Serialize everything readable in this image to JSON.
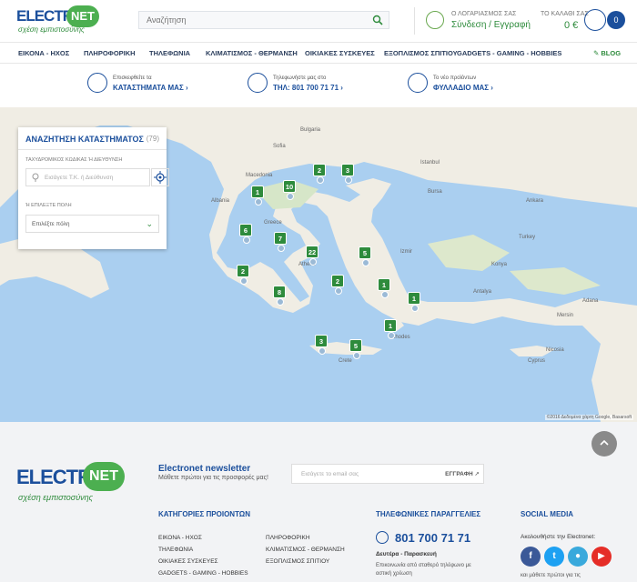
{
  "header": {
    "logo_main": "ELECTRO",
    "logo_net": "NET",
    "logo_tagline": "σχέση εμπιστοσύνης",
    "search_placeholder": "Αναζήτηση",
    "account_label": "Ο ΛΟΓΑΡΙΑΣΜΟΣ ΣΑΣ",
    "account_link": "Σύνδεση / Εγγραφή",
    "cart_label": "ΤΟ ΚΑΛΑΘΙ ΣΑΣ",
    "cart_amount": "0 €",
    "cart_count": "0"
  },
  "nav": {
    "items": [
      "ΕΙΚΟΝΑ - ΗΧΟΣ",
      "ΠΛΗΡΟΦΟΡΙΚΗ",
      "ΤΗΛΕΦΩΝΙΑ",
      "ΚΛΙΜΑΤΙΣΜΟΣ - ΘΕΡΜΑΝΣΗ",
      "ΟΙΚΙΑΚΕΣ ΣΥΣΚΕΥΕΣ",
      "ΕΞΟΠΛΙΣΜΟΣ ΣΠΙΤΙΟΥ",
      "GADGETS - GAMING - HOBBIES"
    ],
    "blog": "BLOG"
  },
  "services": [
    {
      "small": "Επισκεφθείτε τα",
      "big": "ΚΑΤΑΣΤΗΜΑΤΑ ΜΑΣ ›",
      "icon": "map-pin-icon"
    },
    {
      "small": "Τηλεφωνήστε μας στο",
      "big": "ΤΗΛ: 801 700 71 71 ›",
      "icon": "phone-icon"
    },
    {
      "small": "Το νέο προϊόντων",
      "big": "ΦΥΛΛΑΔΙΟ ΜΑΣ ›",
      "icon": "brochure-icon"
    }
  ],
  "store_finder": {
    "title": "ΑΝΑΖΗΤΗΣΗ ΚΑΤΑΣΤΗΜΑΤΟΣ",
    "count": "(79)",
    "postal_label": "ΤΑΧΥΔΡΟΜΙΚΟΣ ΚΩΔΙΚΑΣ Ή ΔΙΕΥΘΥΝΣΗ",
    "postal_placeholder": "Εισάγετε Τ.Κ. ή Διεύθυνση",
    "city_label": "Ή ΕΠΙΛΕΞΤΕ ΠΟΛΗ",
    "city_value": "Επιλέξτε πόλη"
  },
  "map": {
    "credit": "©2016 Δεδομένα χάρτη Google, Basarsoft",
    "markers": [
      {
        "label": "2"
      },
      {
        "label": "3"
      },
      {
        "label": "1"
      },
      {
        "label": "10"
      },
      {
        "label": "6"
      },
      {
        "label": "7"
      },
      {
        "label": "22"
      },
      {
        "label": "5"
      },
      {
        "label": "2"
      },
      {
        "label": "2"
      },
      {
        "label": "8"
      },
      {
        "label": "1"
      },
      {
        "label": "1"
      },
      {
        "label": "1"
      },
      {
        "label": "3"
      },
      {
        "label": "5"
      }
    ],
    "places": [
      "Bulgaria",
      "Sofia",
      "Macedonia",
      "Albania",
      "Greece",
      "Athens",
      "Istanbul",
      "Bursa",
      "Izmir",
      "Antalya",
      "Turkey",
      "Ankara",
      "Konya",
      "Crete",
      "Rhodes",
      "Cyprus",
      "Nicosia",
      "Mersin",
      "Adana"
    ]
  },
  "footer": {
    "logo_main": "ELECTRO",
    "logo_net": "NET",
    "logo_tagline": "σχέση εμπιστοσύνης",
    "newsletter_title": "Electronet newsletter",
    "newsletter_sub": "Μάθετε πρώτοι για τις προσφορές μας!",
    "newsletter_placeholder": "Εισάγετε το email σας",
    "newsletter_button": "ΕΓΓΡΑΦΗ",
    "categories_title": "ΚΑΤΗΓΟΡΙΕΣ ΠΡΟΙΟΝΤΩΝ",
    "categories": [
      "ΕΙΚΟΝΑ - ΗΧΟΣ",
      "ΠΛΗΡΟΦΟΡΙΚΗ",
      "ΤΗΛΕΦΩΝΙΑ",
      "ΚΛΙΜΑΤΙΣΜΟΣ - ΘΕΡΜΑΝΣΗ",
      "ΟΙΚΙΑΚΕΣ ΣΥΣΚΕΥΕΣ",
      "ΕΞΟΠΛΙΣΜΟΣ ΣΠΙΤΙΟΥ",
      "GADGETS - GAMING - HOBBIES"
    ],
    "phone_title": "ΤΗΛΕΦΩΝΙΚΕΣ ΠΑΡΑΓΓΕΛΙΕΣ",
    "phone_number": "801 700 71 71",
    "phone_days": "Δευτέρα - Παρασκευή",
    "phone_note": "Επικοινωνία από σταθερό τηλέφωνο με αστική χρέωση",
    "social_title": "SOCIAL MEDIA",
    "social_follow": "Ακολουθήστε την Electronet:",
    "social_note": "και μάθετε πρώτοι για τις",
    "social_icons": [
      {
        "name": "facebook-icon",
        "glyph": "f",
        "color": "#3b5998"
      },
      {
        "name": "twitter-icon",
        "glyph": "t",
        "color": "#1da1f2"
      },
      {
        "name": "flickr-icon",
        "glyph": "●",
        "color": "#39a9dc"
      },
      {
        "name": "youtube-icon",
        "glyph": "▶",
        "color": "#e52d27"
      }
    ]
  },
  "colors": {
    "brand_blue": "#1b4f9c",
    "brand_green": "#2e8b3c",
    "sea": "#aacff0",
    "land": "#f0ede4"
  }
}
